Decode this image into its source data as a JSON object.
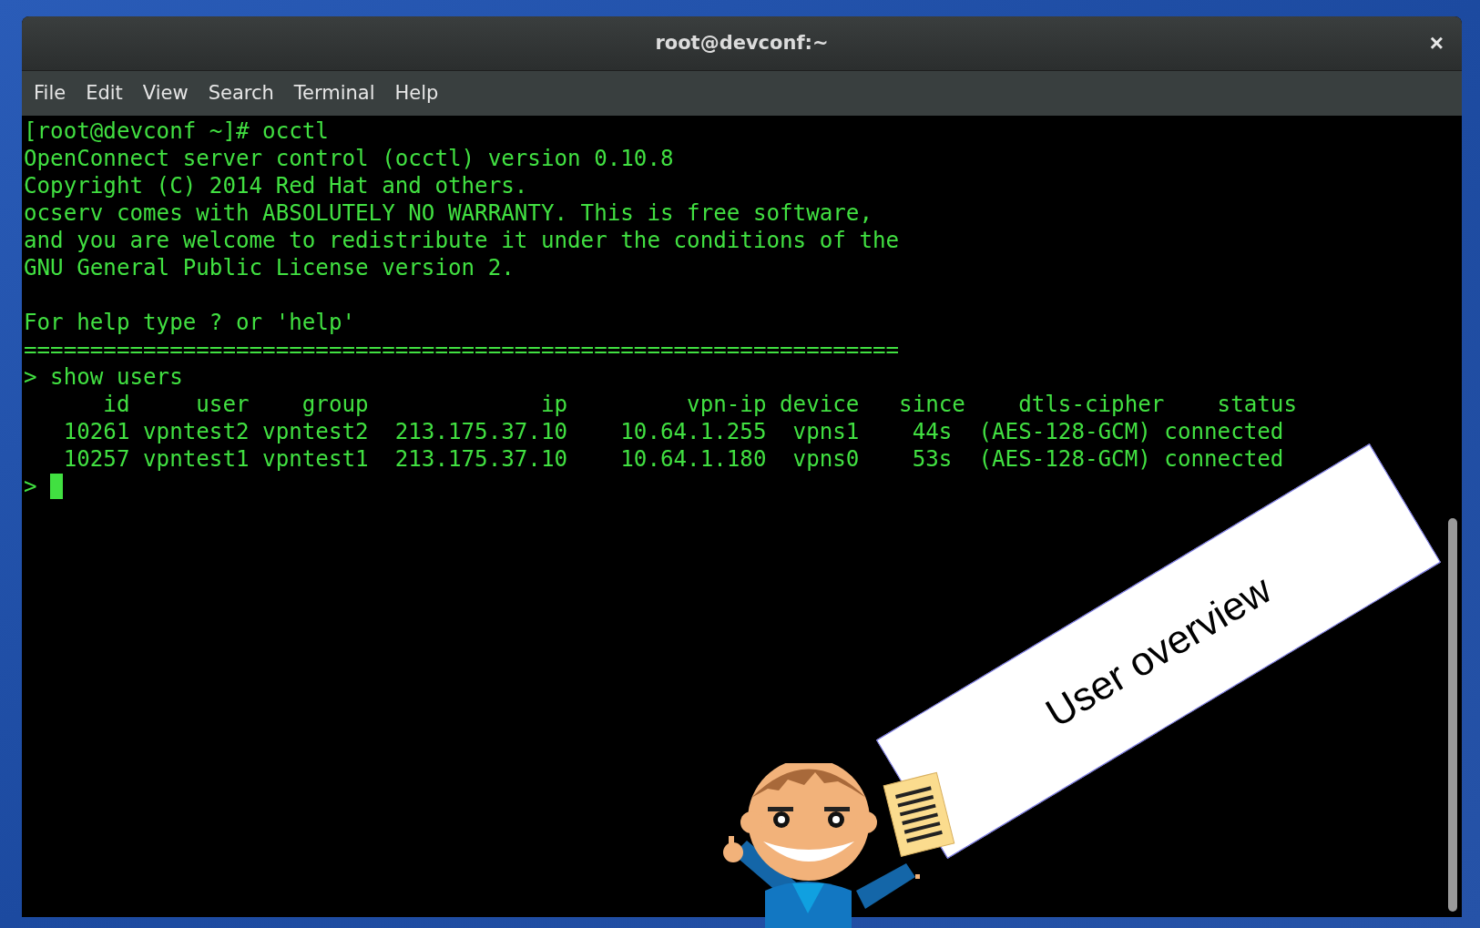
{
  "window": {
    "title": "root@devconf:~",
    "close": "×"
  },
  "menu": [
    "File",
    "Edit",
    "View",
    "Search",
    "Terminal",
    "Help"
  ],
  "terminal": {
    "lines": [
      {
        "kind": "output",
        "text": "[root@devconf ~]# occtl"
      },
      {
        "kind": "output",
        "text": "OpenConnect server control (occtl) version 0.10.8"
      },
      {
        "kind": "output",
        "text": "Copyright (C) 2014 Red Hat and others."
      },
      {
        "kind": "output",
        "text": "ocserv comes with ABSOLUTELY NO WARRANTY. This is free software,"
      },
      {
        "kind": "output",
        "text": "and you are welcome to redistribute it under the conditions of the"
      },
      {
        "kind": "output",
        "text": "GNU General Public License version 2."
      },
      {
        "kind": "blank"
      },
      {
        "kind": "output",
        "text": "For help type ? or 'help'"
      },
      {
        "kind": "output",
        "text": "=================================================================="
      },
      {
        "kind": "output",
        "text": "> show users"
      },
      {
        "kind": "output",
        "text": "      id     user    group             ip         vpn-ip device   since    dtls-cipher    status"
      },
      {
        "kind": "output",
        "text": "   10261 vpntest2 vpntest2  213.175.37.10    10.64.1.255  vpns1    44s  (AES-128-GCM) connected"
      },
      {
        "kind": "output",
        "text": "   10257 vpntest1 vpntest1  213.175.37.10    10.64.1.180  vpns0    53s  (AES-128-GCM) connected"
      },
      {
        "kind": "prompt",
        "text": ">",
        "cursor": true
      }
    ]
  },
  "overlay": {
    "label": "User overview"
  }
}
